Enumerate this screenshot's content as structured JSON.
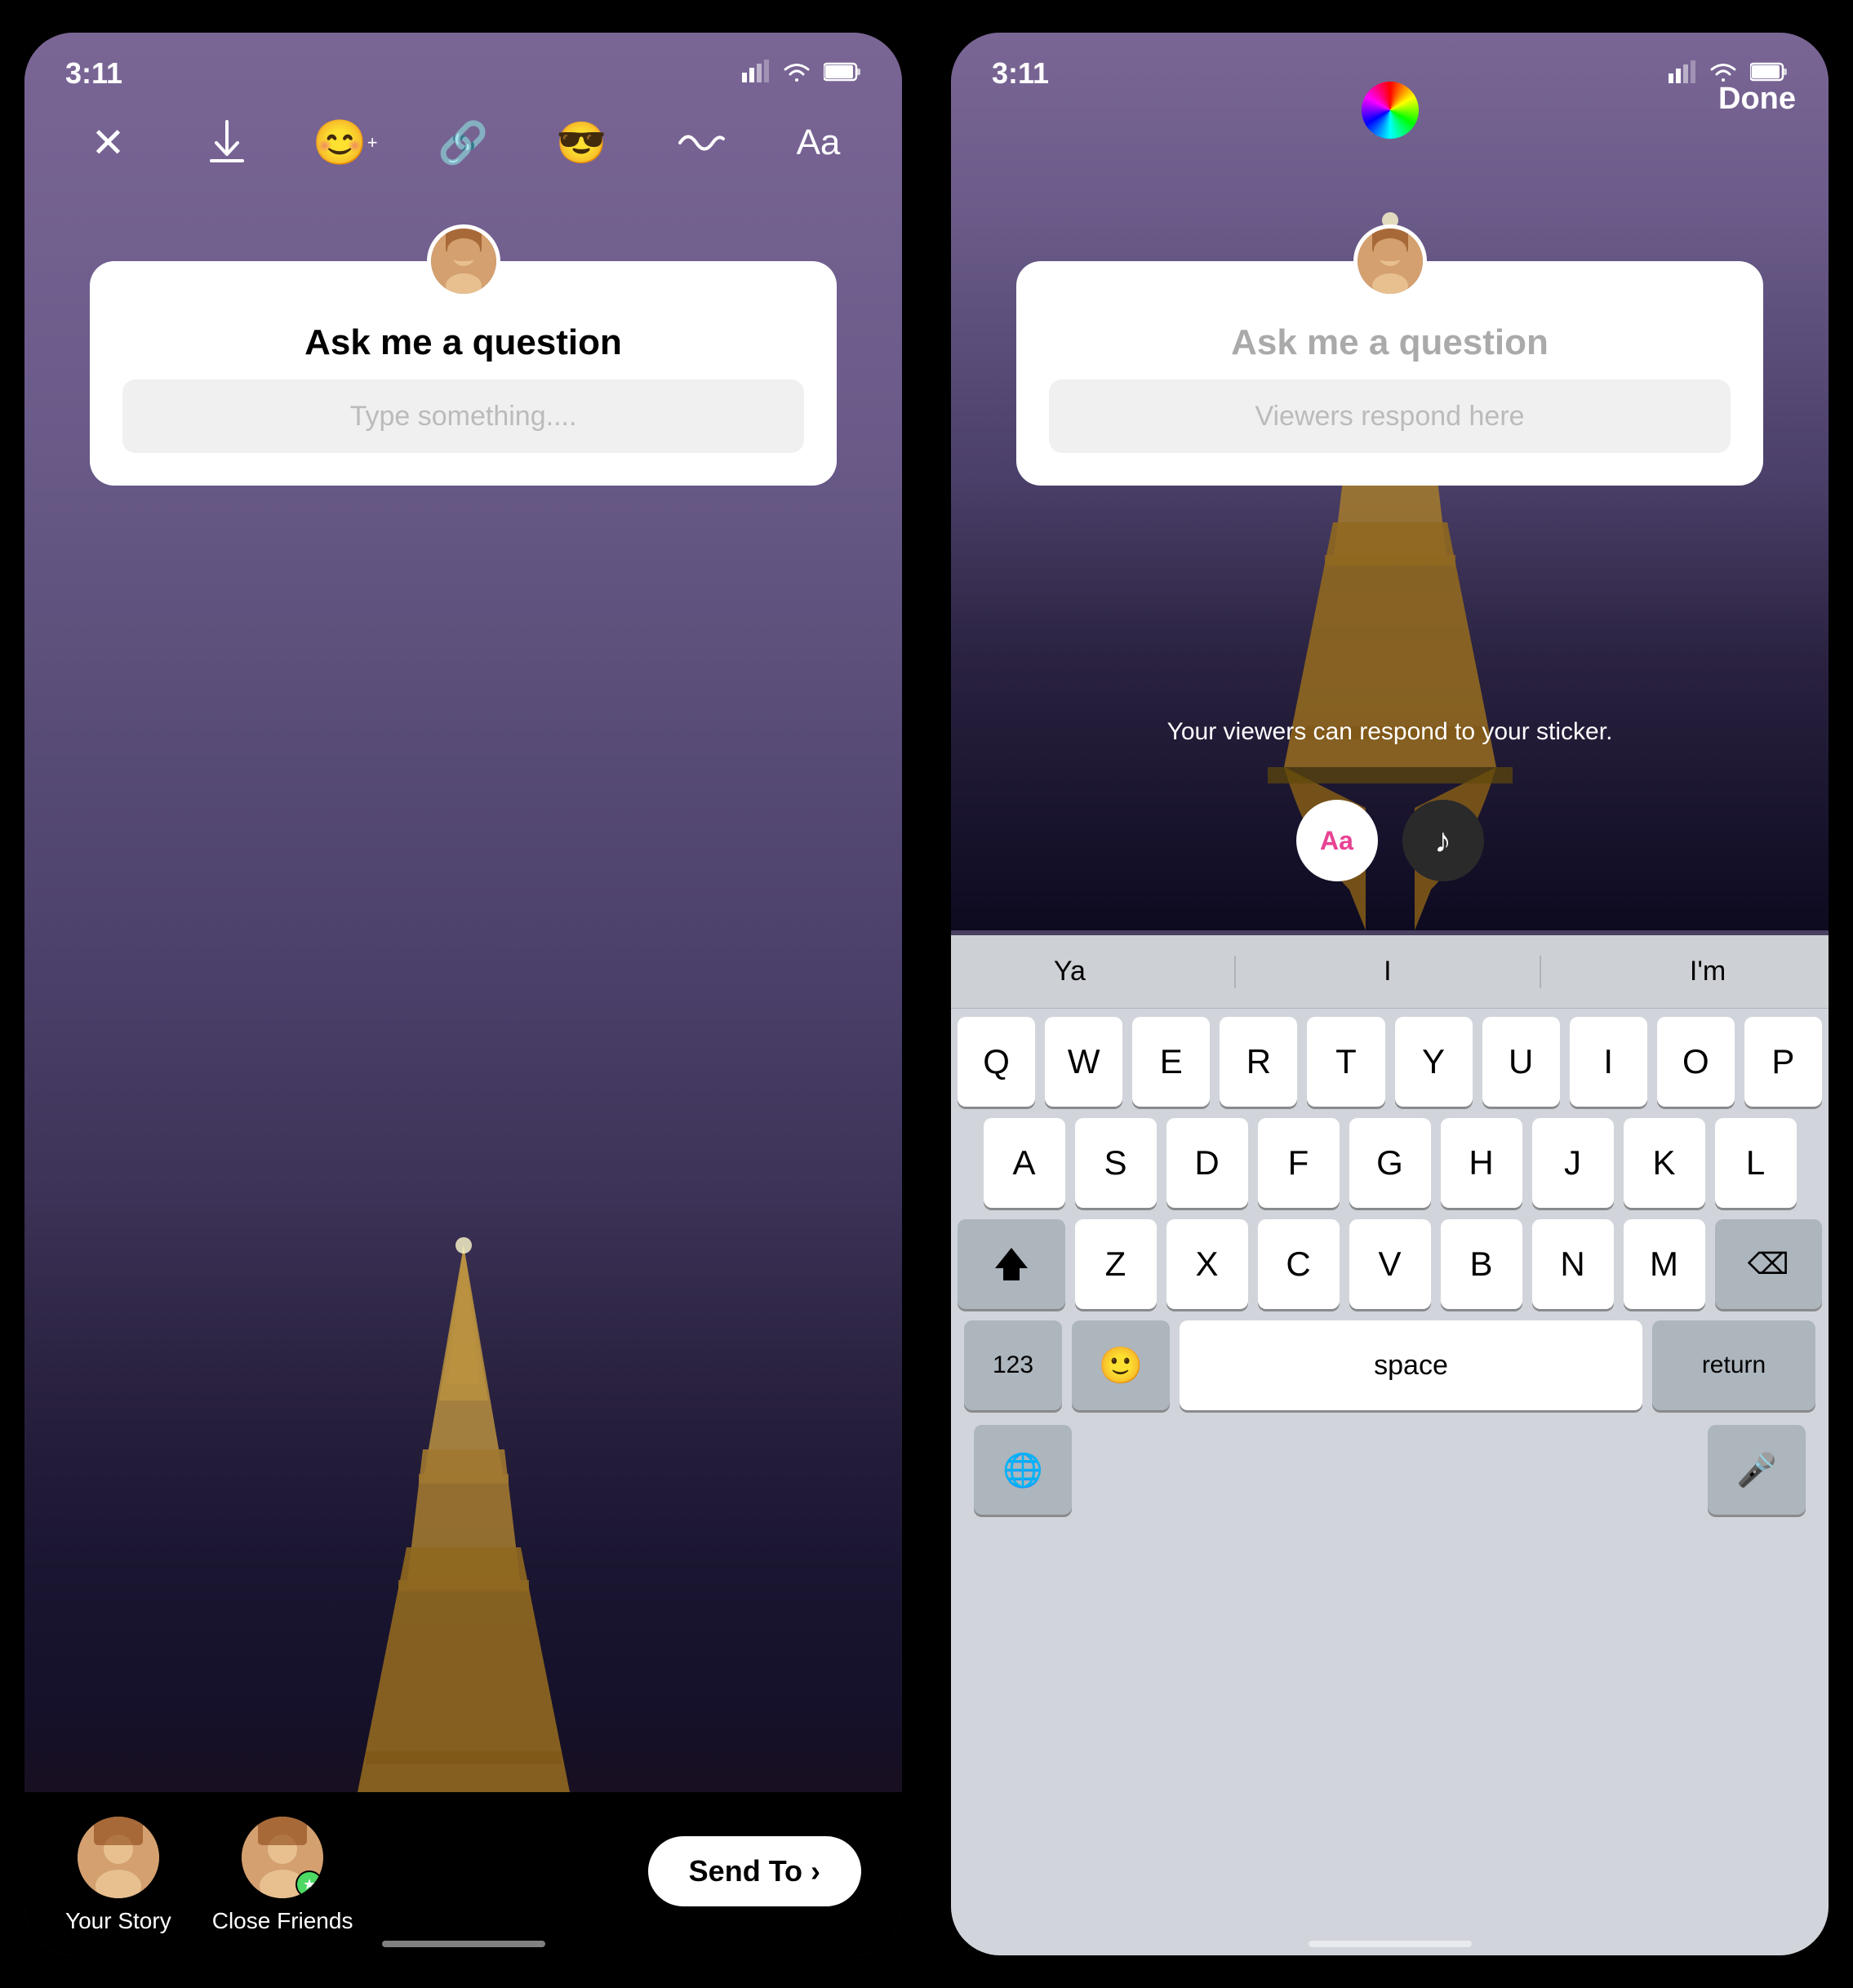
{
  "leftPhone": {
    "statusBar": {
      "time": "3:11",
      "signal": "▲▲",
      "wifi": "wifi",
      "battery": "battery"
    },
    "toolbar": {
      "close": "✕",
      "download": "⬇",
      "emoji": "😊",
      "link": "🔗",
      "sticker": "😎",
      "squiggle": "〰",
      "text": "Aa"
    },
    "questionCard": {
      "title": "Ask me a question",
      "placeholder": "Type something...."
    },
    "bottomBar": {
      "yourStoryLabel": "Your Story",
      "closeFriendsLabel": "Close Friends",
      "sendToLabel": "Send To",
      "sendToArrow": "›"
    }
  },
  "rightPhone": {
    "statusBar": {
      "time": "3:11"
    },
    "doneButton": "Done",
    "questionCard": {
      "title": "Ask me a question",
      "placeholder": "Viewers respond here"
    },
    "viewersText": "Your viewers can respond to your sticker.",
    "textBtn": "Aa",
    "keyboard": {
      "suggestions": [
        "Ya",
        "I",
        "I'm"
      ],
      "row1": [
        "Q",
        "W",
        "E",
        "R",
        "T",
        "Y",
        "U",
        "I",
        "O",
        "P"
      ],
      "row2": [
        "A",
        "S",
        "D",
        "F",
        "G",
        "H",
        "J",
        "K",
        "L"
      ],
      "row3": [
        "Z",
        "X",
        "C",
        "V",
        "B",
        "N",
        "M"
      ],
      "spaceLabel": "space",
      "returnLabel": "return",
      "numberLabel": "123",
      "deleteLabel": "⌫"
    }
  }
}
